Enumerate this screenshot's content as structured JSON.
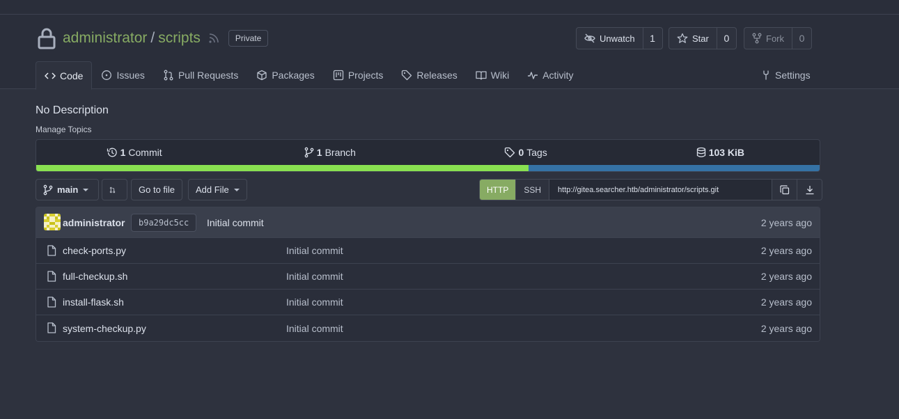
{
  "repo": {
    "owner": "administrator",
    "separator": "/",
    "name": "scripts",
    "visibility": "Private"
  },
  "actions": {
    "watch": {
      "label": "Unwatch",
      "count": "1"
    },
    "star": {
      "label": "Star",
      "count": "0"
    },
    "fork": {
      "label": "Fork",
      "count": "0"
    }
  },
  "tabs": [
    {
      "label": "Code",
      "icon": "code-icon",
      "active": true
    },
    {
      "label": "Issues",
      "icon": "issue-icon"
    },
    {
      "label": "Pull Requests",
      "icon": "pull-request-icon"
    },
    {
      "label": "Packages",
      "icon": "package-icon"
    },
    {
      "label": "Projects",
      "icon": "project-icon"
    },
    {
      "label": "Releases",
      "icon": "tag-icon"
    },
    {
      "label": "Wiki",
      "icon": "book-icon"
    },
    {
      "label": "Activity",
      "icon": "pulse-icon"
    }
  ],
  "settings_label": "Settings",
  "description": "No Description",
  "manage_topics": "Manage Topics",
  "stats": {
    "commits": {
      "count": "1",
      "label": "Commit"
    },
    "branches": {
      "count": "1",
      "label": "Branch"
    },
    "tags": {
      "count": "0",
      "label": "Tags"
    },
    "size": "103 KiB"
  },
  "languages": {
    "colors": [
      "#89e051",
      "#3572a5"
    ],
    "first_share": 0.628
  },
  "toolbar": {
    "branch": "main",
    "goto_file": "Go to file",
    "add_file": "Add File",
    "http": "HTTP",
    "ssh": "SSH",
    "clone_url": "http://gitea.searcher.htb/administrator/scripts.git"
  },
  "latest_commit": {
    "author": "administrator",
    "sha": "b9a29dc5cc",
    "message": "Initial commit",
    "time": "2 years ago"
  },
  "files": [
    {
      "name": "check-ports.py",
      "message": "Initial commit",
      "time": "2 years ago"
    },
    {
      "name": "full-checkup.sh",
      "message": "Initial commit",
      "time": "2 years ago"
    },
    {
      "name": "install-flask.sh",
      "message": "Initial commit",
      "time": "2 years ago"
    },
    {
      "name": "system-checkup.py",
      "message": "Initial commit",
      "time": "2 years ago"
    }
  ],
  "colors": {
    "accent": "#87ab63",
    "background": "#2e323e",
    "header": "#2a2e3a"
  }
}
